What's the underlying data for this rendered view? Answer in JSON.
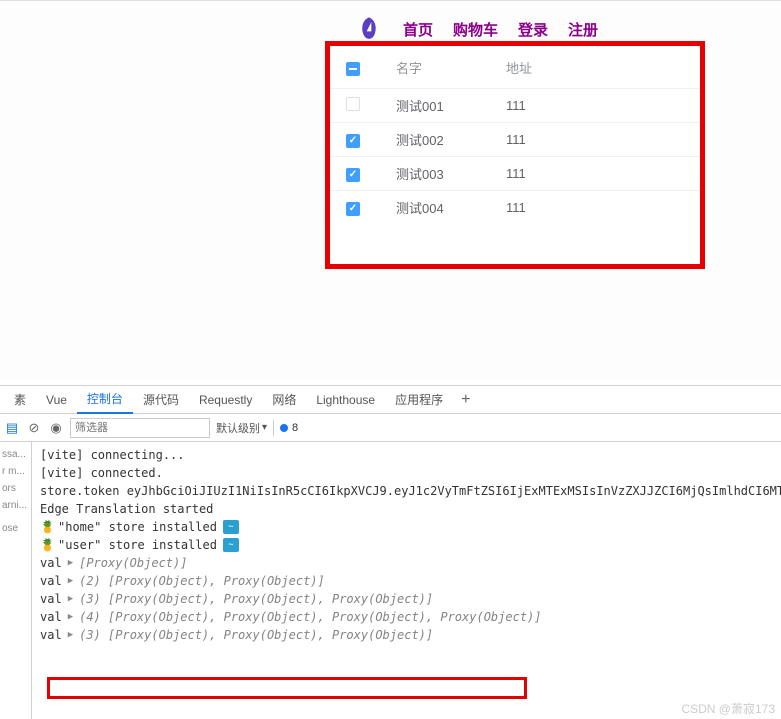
{
  "nav": {
    "links": [
      "首页",
      "购物车",
      "登录",
      "注册"
    ]
  },
  "table": {
    "headers": {
      "name": "名字",
      "addr": "地址"
    },
    "rows": [
      {
        "checked": false,
        "name": "测试001",
        "addr": "111"
      },
      {
        "checked": true,
        "name": "测试002",
        "addr": "111"
      },
      {
        "checked": true,
        "name": "测试003",
        "addr": "111"
      },
      {
        "checked": true,
        "name": "测试004",
        "addr": "111"
      }
    ]
  },
  "devtools": {
    "tabs": [
      "素",
      "Vue",
      "控制台",
      "源代码",
      "Requestly",
      "网络",
      "Lighthouse",
      "应用程序"
    ],
    "active_tab": "控制台",
    "filter_placeholder": "筛选器",
    "level_label": "默认级别",
    "issue_count": "8",
    "sidebar": [
      "ssa...",
      "r m...",
      "ors",
      "arni...",
      "",
      "ose"
    ],
    "logs": [
      {
        "type": "plain",
        "text": "[vite] connecting..."
      },
      {
        "type": "plain",
        "text": "[vite] connected."
      },
      {
        "type": "plain",
        "text": "store.token eyJhbGciOiJIUzI1NiIsInR5cCI6IkpXVCJ9.eyJ1c2VyTmFtZSI6IjExMTExMSIsInVzZXJJZCI6MjQsImlhdCI6MT"
      },
      {
        "type": "plain",
        "text": "Edge Translation started"
      },
      {
        "type": "pinia",
        "text": "\"home\" store installed"
      },
      {
        "type": "pinia",
        "text": "\"user\" store installed"
      },
      {
        "type": "val",
        "label": "val",
        "obj": "[Proxy(Object)]",
        "count": ""
      },
      {
        "type": "val",
        "label": "val",
        "obj": "[Proxy(Object), Proxy(Object)]",
        "count": "(2) "
      },
      {
        "type": "val",
        "label": "val",
        "obj": "[Proxy(Object), Proxy(Object), Proxy(Object)]",
        "count": "(3) "
      },
      {
        "type": "val",
        "label": "val",
        "obj": "[Proxy(Object), Proxy(Object), Proxy(Object), Proxy(Object)]",
        "count": "(4) "
      },
      {
        "type": "val",
        "label": "val",
        "obj": "[Proxy(Object), Proxy(Object), Proxy(Object)]",
        "count": "(3) "
      }
    ]
  },
  "watermark": "CSDN @萧寂173"
}
